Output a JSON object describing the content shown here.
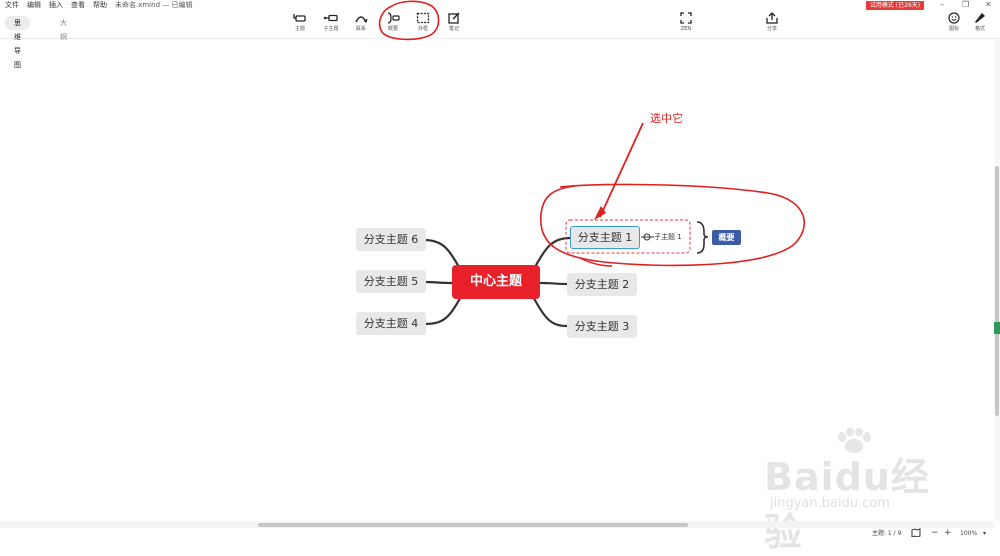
{
  "menubar": {
    "items": [
      "文件",
      "编辑",
      "插入",
      "查看",
      "帮助"
    ],
    "document_title": "未命名.xmind — 已编辑",
    "trial_badge": "试用模式 (已26天)",
    "window_controls": [
      "–",
      "❐",
      "✕"
    ]
  },
  "view_tabs": {
    "mindmap": "思维导图",
    "outline": "大纲"
  },
  "toolbar": {
    "topic": "主题",
    "subtopic": "子主题",
    "relationship": "联系",
    "summary": "概要",
    "boundary": "外框",
    "note": "笔记",
    "zen": "ZEN",
    "share": "分享",
    "icons": "图标",
    "format": "格式"
  },
  "mindmap": {
    "central_topic": "中心主题",
    "branches_right": [
      "分支主题 1",
      "分支主题 2",
      "分支主题 3"
    ],
    "branches_left": [
      "分支主题 6",
      "分支主题 5",
      "分支主题 4"
    ],
    "subtopic": "子主题 1",
    "summary_label": "概要",
    "selected_branch": "分支主题 1"
  },
  "annotation": {
    "text": "选中它",
    "color": "#e02020"
  },
  "statusbar": {
    "topic_count": "主题: 1 / 9",
    "zoom": "100%"
  },
  "watermark": {
    "brand": "Baidu经验",
    "url": "jingyan.baidu.com"
  },
  "colors": {
    "central": "#e8202a",
    "summary": "#3b5ba5",
    "selection": "#3a9ad9",
    "annotation": "#e02020",
    "trial": "#e43b3b"
  }
}
